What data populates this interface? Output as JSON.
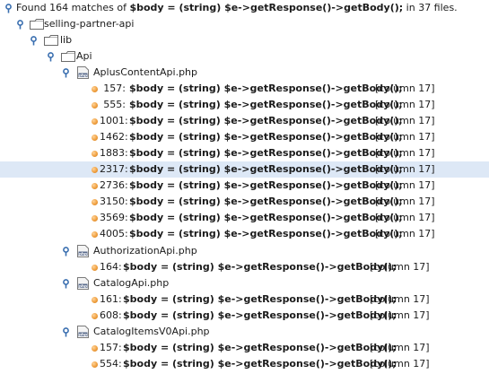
{
  "summary": {
    "prefix": "Found 164 matches of ",
    "query": "$body = (string) $e->getResponse()->getBody();",
    "suffix": " in 37 files."
  },
  "tree": {
    "root_folder": "selling-partner-api",
    "lib_folder": "lib",
    "api_folder": "Api",
    "files": [
      {
        "name": "AplusContentApi.php",
        "matches": [
          {
            "line": "157:",
            "code": "$body = (string) $e->getResponse()->getBody();",
            "column": "[column 17]"
          },
          {
            "line": "555:",
            "code": "$body = (string) $e->getResponse()->getBody();",
            "column": "[column 17]"
          },
          {
            "line": "1001:",
            "code": "$body = (string) $e->getResponse()->getBody();",
            "column": "[column 17]"
          },
          {
            "line": "1462:",
            "code": "$body = (string) $e->getResponse()->getBody();",
            "column": "[column 17]"
          },
          {
            "line": "1883:",
            "code": "$body = (string) $e->getResponse()->getBody();",
            "column": "[column 17]"
          },
          {
            "line": "2317:",
            "code": "$body = (string) $e->getResponse()->getBody();",
            "column": "[column 17]"
          },
          {
            "line": "2736:",
            "code": "$body = (string) $e->getResponse()->getBody();",
            "column": "[column 17]"
          },
          {
            "line": "3150:",
            "code": "$body = (string) $e->getResponse()->getBody();",
            "column": "[column 17]"
          },
          {
            "line": "3569:",
            "code": "$body = (string) $e->getResponse()->getBody();",
            "column": "[column 17]"
          },
          {
            "line": "4005:",
            "code": "$body = (string) $e->getResponse()->getBody();",
            "column": "[column 17]"
          }
        ]
      },
      {
        "name": "AuthorizationApi.php",
        "matches": [
          {
            "line": "164:",
            "code": "$body = (string) $e->getResponse()->getBody();",
            "column": "[column 17]"
          }
        ]
      },
      {
        "name": "CatalogApi.php",
        "matches": [
          {
            "line": "161:",
            "code": "$body = (string) $e->getResponse()->getBody();",
            "column": "[column 17]"
          },
          {
            "line": "608:",
            "code": "$body = (string) $e->getResponse()->getBody();",
            "column": "[column 17]"
          }
        ]
      },
      {
        "name": "CatalogItemsV0Api.php",
        "matches": [
          {
            "line": "157:",
            "code": "$body = (string) $e->getResponse()->getBody();",
            "column": "[column 17]"
          },
          {
            "line": "554:",
            "code": "$body = (string) $e->getResponse()->getBody();",
            "column": "[column 17]"
          }
        ]
      }
    ]
  },
  "colors": {
    "selection": "#dde8f6",
    "toggle": "#3a6fb0",
    "bullet": "#f0a040"
  },
  "icons": {
    "toggle": "expanded-toggle-icon",
    "folder": "folder-icon",
    "file": "php-file-icon",
    "match": "match-bullet-icon"
  }
}
